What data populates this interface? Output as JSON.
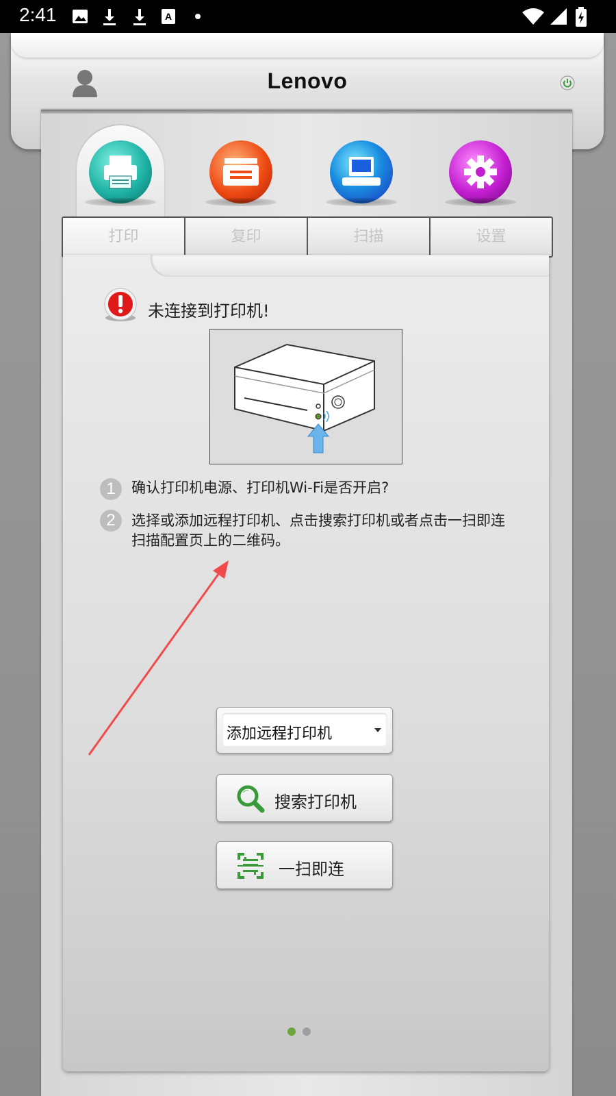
{
  "status_bar": {
    "time": "2:41",
    "icons": [
      "image-icon",
      "download-icon",
      "download-icon",
      "font-icon",
      "dot-icon",
      "wifi-icon",
      "signal-icon",
      "battery-icon"
    ]
  },
  "header": {
    "brand": "Lenovo",
    "avatar_icon": "user-icon",
    "power_icon": "power-icon"
  },
  "tabs": [
    {
      "label": "打印",
      "icon": "printer-icon",
      "color": "#1fb3a6",
      "active": true
    },
    {
      "label": "复印",
      "icon": "copier-icon",
      "color": "#ee4a14",
      "active": false
    },
    {
      "label": "扫描",
      "icon": "scanner-icon",
      "color": "#1a5fe0",
      "active": false
    },
    {
      "label": "设置",
      "icon": "gear-icon",
      "color": "#b21ec0",
      "active": false
    }
  ],
  "main": {
    "warning": "未连接到打印机!",
    "steps": [
      {
        "num": "1",
        "text": "确认打印机电源、打印机Wi-Fi是否开启?"
      },
      {
        "num": "2",
        "text": "选择或添加远程打印机、点击搜索打印机或者点击一扫即连扫描配置页上的二维码。"
      }
    ],
    "select_value": "添加远程打印机",
    "search_button": "搜索打印机",
    "scan_button": "一扫即连",
    "page_indicator": {
      "count": 2,
      "current": 1
    }
  },
  "colors": {
    "accent_green": "#3a9a3a",
    "active_dot": "#6aa63a",
    "inactive_dot": "#9e9e9e",
    "arrow_red": "#f04a4a"
  }
}
